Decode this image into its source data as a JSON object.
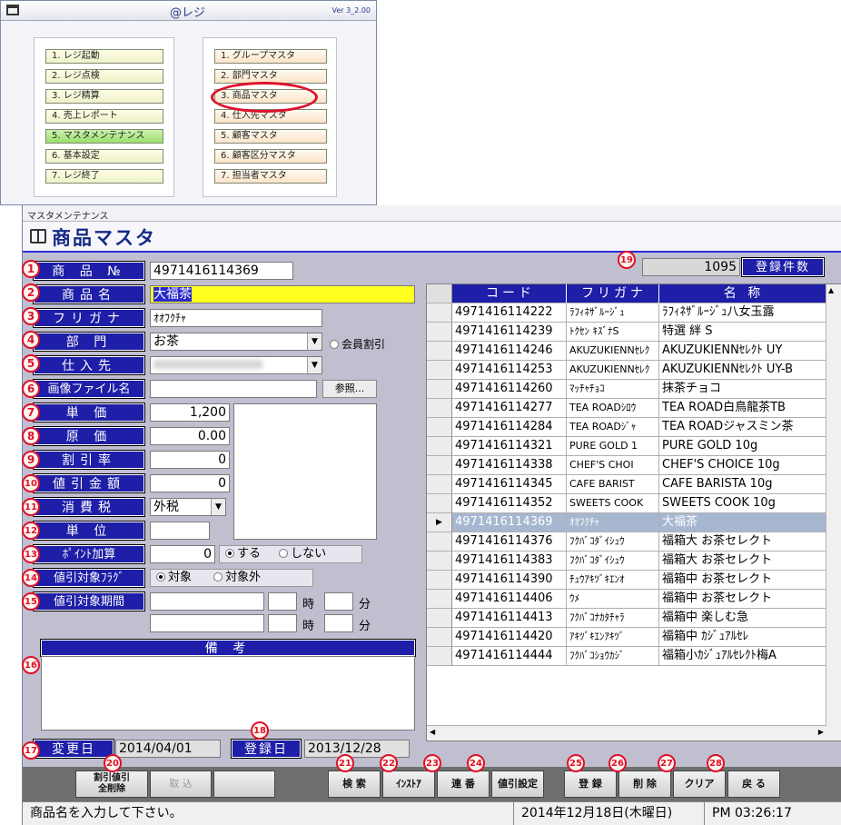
{
  "launcher": {
    "title": "@レジ",
    "version": "Ver 3_2.00",
    "left_menu": [
      "1. レジ起動",
      "2. レジ点検",
      "3. レジ精算",
      "4. 売上レポート",
      "5. マスタメンテナンス",
      "6. 基本設定",
      "7. レジ終了"
    ],
    "right_menu": [
      "1. グループマスタ",
      "2. 部門マスタ",
      "3. 商品マスタ",
      "4. 仕入先マスタ",
      "5. 顧客マスタ",
      "6. 顧客区分マスタ",
      "7. 担当者マスタ"
    ]
  },
  "window": {
    "title": "マスタメンテナンス",
    "header": "商品マスタ"
  },
  "form": {
    "code_label": "商 品 №",
    "code_value": "4971416114369",
    "name_label": "商品名",
    "name_value": "大福茶",
    "kana_label": "フリガナ",
    "kana_value": "ｵｵﾌｸﾁｬ",
    "dept_label": "部 門",
    "dept_value": "お茶",
    "member_discount": "会員割引",
    "supplier_label": "仕入先",
    "supplier_value": "",
    "image_label": "画像ファイル名",
    "image_value": "",
    "browse_button": "参照...",
    "price_label": "単 価",
    "price_value": "1,200",
    "cost_label": "原 価",
    "cost_value": "0.00",
    "discount_rate_label": "割引率",
    "discount_rate_value": "0",
    "discount_amount_label": "値引金額",
    "discount_amount_value": "0",
    "tax_label": "消費税",
    "tax_value": "外税",
    "unit_label": "単 位",
    "unit_value": "",
    "points_label": "ﾎﾟｲﾝﾄ加算",
    "points_value": "0",
    "points_yes": "する",
    "points_no": "しない",
    "discount_flag_label": "値引対象ﾌﾗｸﾞ",
    "flag_target": "対象",
    "flag_excluded": "対象外",
    "discount_period_label": "値引対象期間",
    "hour": "時",
    "minute": "分",
    "notes_label": "備 考",
    "changed_label": "変更日",
    "changed_value": "2014/04/01",
    "registered_label": "登録日",
    "registered_value": "2013/12/28"
  },
  "count": {
    "value": "1095",
    "label": "登録件数"
  },
  "grid": {
    "headers": [
      "コード",
      "フリガナ",
      "名 称"
    ],
    "rows": [
      [
        "4971416114222",
        "ﾗﾌｨﾈｻﾞﾙｰｼﾞｭ",
        "ﾗﾌｨﾈｻﾞﾙｰｼﾞｭ八女玉露"
      ],
      [
        "4971416114239",
        "ﾄｸｾﾝ ｷｽﾞﾅS",
        "特選 絆 S"
      ],
      [
        "4971416114246",
        "AKUZUKIENNｾﾚｸ",
        "AKUZUKIENNｾﾚｸﾄ UY"
      ],
      [
        "4971416114253",
        "AKUZUKIENNｾﾚｸ",
        "AKUZUKIENNｾﾚｸﾄ UY-B"
      ],
      [
        "4971416114260",
        "ﾏｯﾁｬﾁｮｺ",
        "抹茶チョコ"
      ],
      [
        "4971416114277",
        "TEA ROADｼﾛｳ",
        "TEA ROAD白鳥龍茶TB"
      ],
      [
        "4971416114284",
        "TEA ROADｼﾞｬ",
        "TEA ROADジャスミン茶"
      ],
      [
        "4971416114321",
        "PURE GOLD 1",
        "PURE GOLD 10g"
      ],
      [
        "4971416114338",
        "CHEF'S CHOI",
        "CHEF'S CHOICE 10g"
      ],
      [
        "4971416114345",
        "CAFE BARIST",
        "CAFE BARISTA 10g"
      ],
      [
        "4971416114352",
        "SWEETS COOK",
        "SWEETS COOK 10g"
      ],
      [
        "4971416114369",
        "ｵｵﾌｸﾁｬ",
        "大福茶"
      ],
      [
        "4971416114376",
        "ﾌｸﾊﾞｺﾀﾞｲｼｭｳ",
        "福箱大 お茶セレクト"
      ],
      [
        "4971416114383",
        "ﾌｸﾊﾞｺﾀﾞｲｼｭｳ",
        "福箱大 お茶セレクト"
      ],
      [
        "4971416114390",
        "ﾁｭｳｱｷﾂﾞｷｴﾝｵ",
        "福箱中 お茶セレクト"
      ],
      [
        "4971416114406",
        "ｳﾒ",
        "福箱中 お茶セレクト"
      ],
      [
        "4971416114413",
        "ﾌｸﾊﾞｺﾅｶﾀﾁｬﾗ",
        "福箱中 楽しむ急"
      ],
      [
        "4971416114420",
        "ｱｷﾂﾞｷｴﾝｱｷﾂﾞ",
        "福箱中 ｶｼﾞｭｱﾙｾﾚ"
      ],
      [
        "4971416114444",
        "ﾌｸﾊﾞｺｼｮｳｶｼﾞ",
        "福箱小ｶｼﾞｭｱﾙｾﾚｸﾄ梅A"
      ]
    ],
    "selected_index": 11
  },
  "toolbar": {
    "bulk_delete": "割引値引\n全削除",
    "import": "取 込",
    "search": "検 索",
    "install": "ｲﾝｽﾄｱ",
    "serial": "連 番",
    "discount_settings": "値引設定",
    "register": "登 録",
    "delete": "削 除",
    "clear": "クリア",
    "back": "戻 る"
  },
  "status": {
    "message": "商品名を入力して下さい。",
    "date": "2014年12月18日(木曜日)",
    "time": "PM 03:26:17"
  },
  "markers": [
    "1",
    "2",
    "3",
    "4",
    "5",
    "6",
    "7",
    "8",
    "9",
    "10",
    "11",
    "12",
    "13",
    "14",
    "15",
    "16",
    "17",
    "18",
    "19",
    "20",
    "21",
    "22",
    "23",
    "24",
    "25",
    "26",
    "27",
    "28"
  ]
}
